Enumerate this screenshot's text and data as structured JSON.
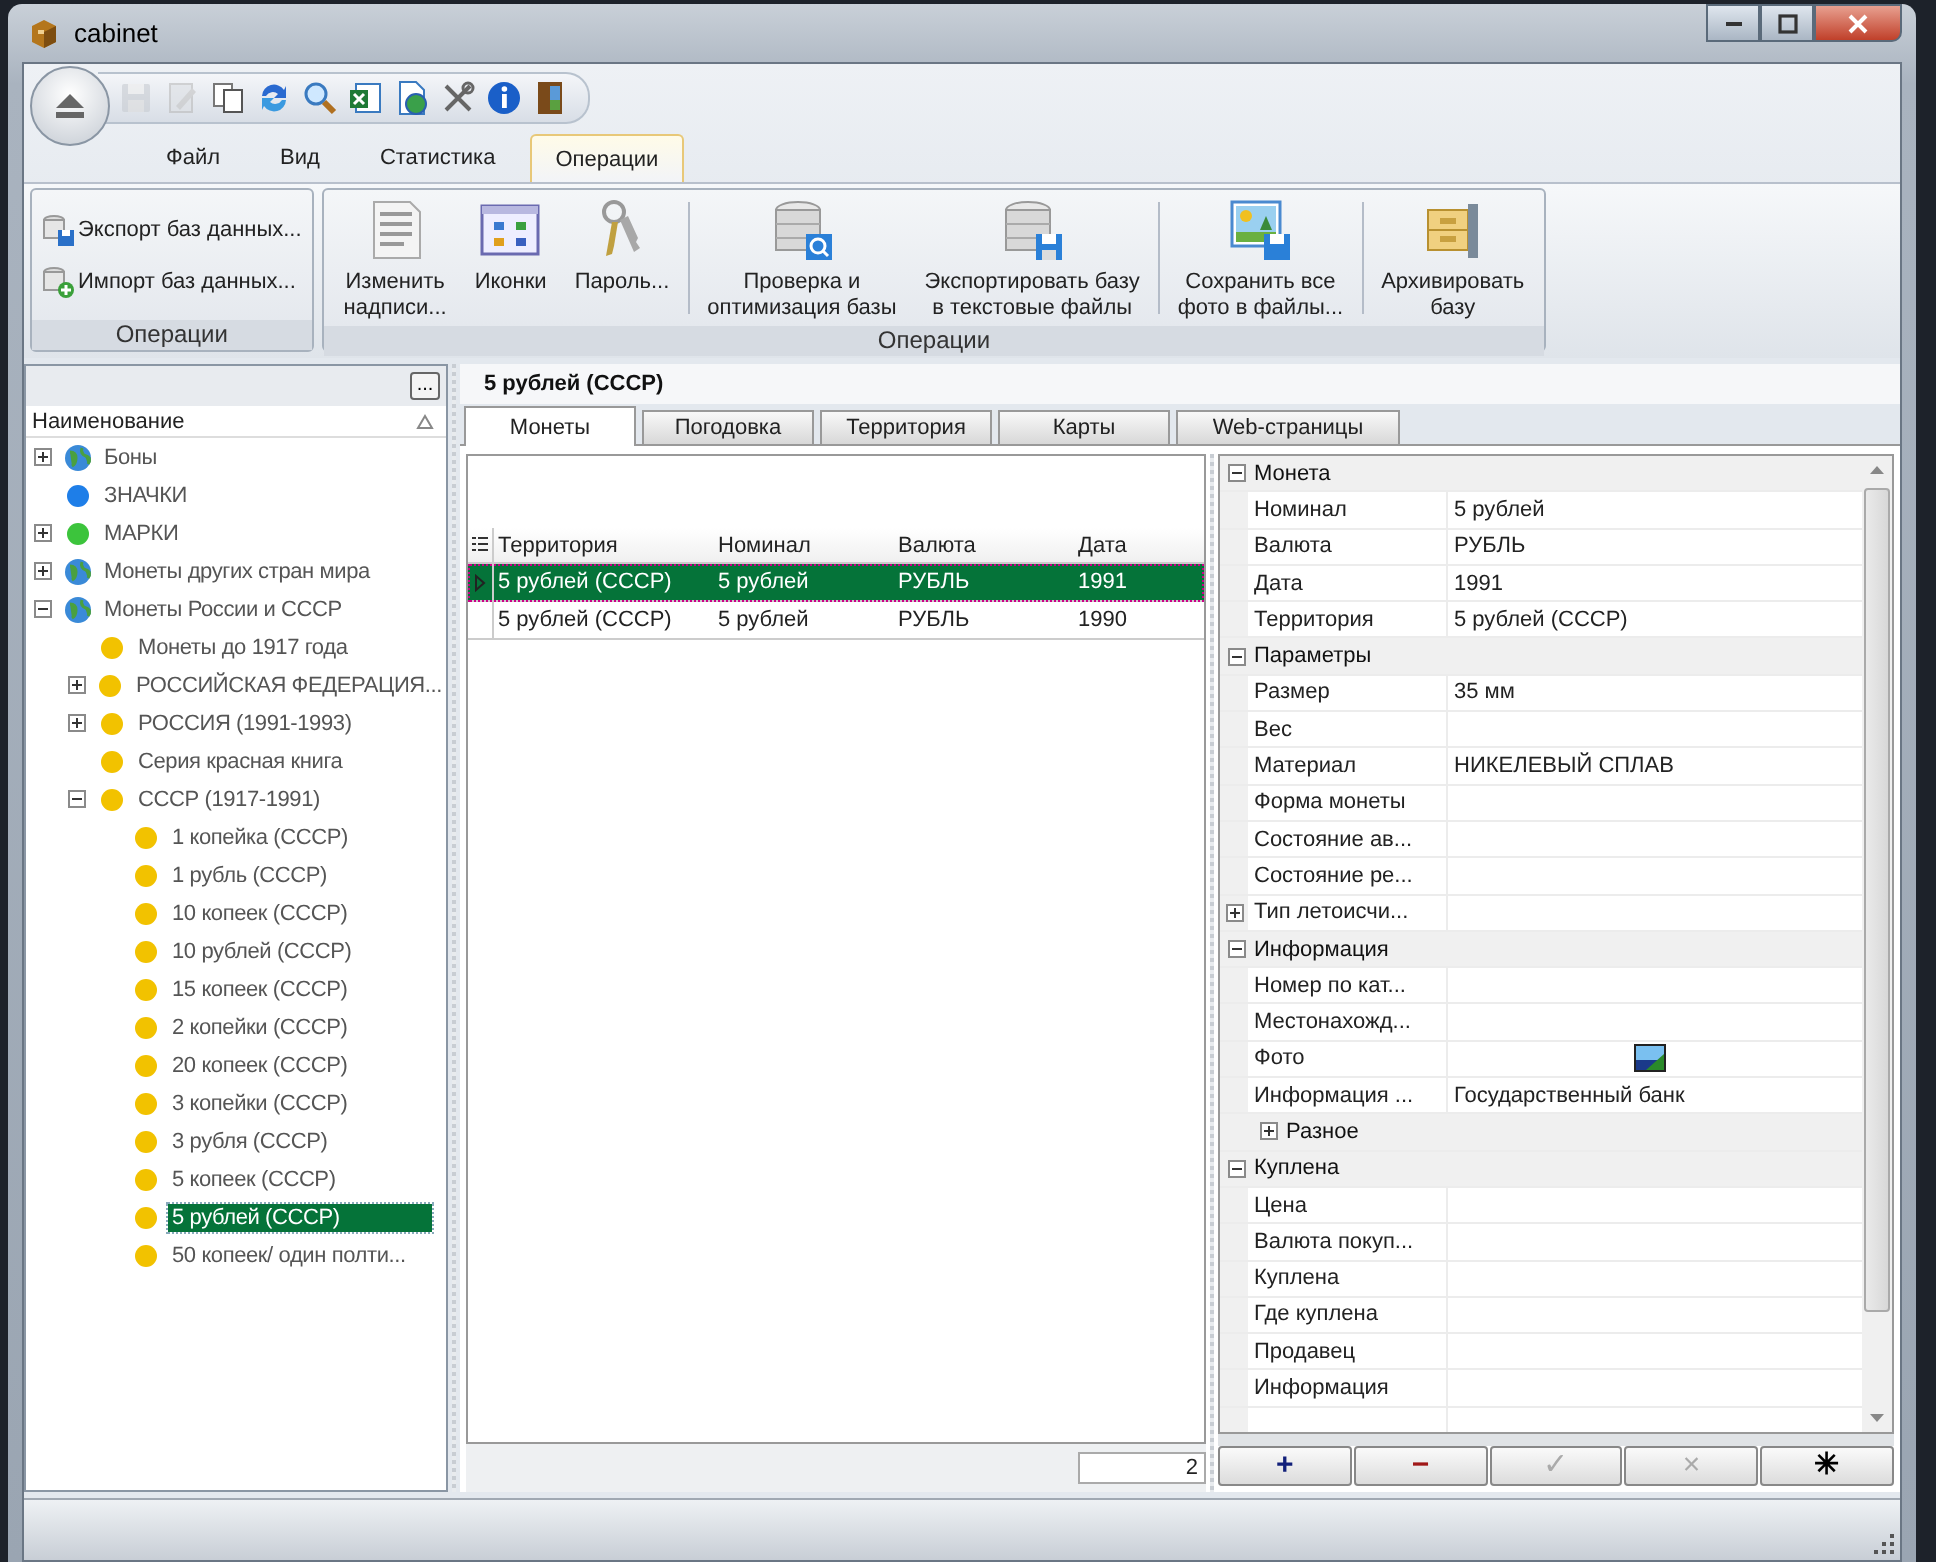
{
  "window": {
    "title": "cabinet"
  },
  "quick_access": [
    {
      "kind": "save",
      "disabled": true
    },
    {
      "kind": "edit",
      "disabled": true
    },
    {
      "kind": "copy",
      "disabled": false
    },
    {
      "kind": "refresh",
      "disabled": false
    },
    {
      "kind": "search",
      "disabled": false
    },
    {
      "kind": "excel",
      "disabled": false
    },
    {
      "kind": "web-doc",
      "disabled": false
    },
    {
      "kind": "tools",
      "disabled": false
    },
    {
      "kind": "info",
      "disabled": false
    },
    {
      "kind": "exit",
      "disabled": false
    }
  ],
  "ribbon_tabs": [
    {
      "label": "Файл",
      "selected": false
    },
    {
      "label": "Вид",
      "selected": false
    },
    {
      "label": "Статистика",
      "selected": false
    },
    {
      "label": "Операции",
      "selected": true
    }
  ],
  "ribbon_groups": [
    {
      "title": "Операции",
      "kind": "small",
      "buttons": [
        {
          "kind": "export",
          "label": "Экспорт баз данных..."
        },
        {
          "kind": "import",
          "label": "Импорт баз данных..."
        }
      ]
    },
    {
      "title": "Операции",
      "kind": "large",
      "sections": [
        {
          "buttons": [
            {
              "kind": "labels",
              "lines": [
                "Изменить",
                "надписи..."
              ]
            },
            {
              "kind": "icons",
              "lines": [
                "Иконки"
              ]
            },
            {
              "kind": "keys",
              "lines": [
                "Пароль..."
              ]
            }
          ]
        },
        {
          "buttons": [
            {
              "kind": "check",
              "lines": [
                "Проверка и",
                "оптимизация базы"
              ]
            },
            {
              "kind": "export",
              "lines": [
                "Экспортировать базу",
                "в текстовые файлы"
              ]
            }
          ]
        },
        {
          "buttons": [
            {
              "kind": "photos",
              "lines": [
                "Сохранить все",
                "фото в файлы..."
              ]
            }
          ]
        },
        {
          "buttons": [
            {
              "kind": "archive",
              "lines": [
                "Архивировать",
                "базу"
              ]
            }
          ]
        }
      ]
    }
  ],
  "tree_panel": {
    "options_button": "...",
    "header": "Наименование",
    "items": [
      {
        "label": "Боны",
        "kind": "globe",
        "expanded": false,
        "selected": false
      },
      {
        "label": "ЗНАЧКИ",
        "kind": "dot",
        "color": "#1e7ee8",
        "selected": false
      },
      {
        "label": "МАРКИ",
        "kind": "dot",
        "color": "#3cc43c",
        "expanded": false,
        "selected": false
      },
      {
        "label": "Монеты других стран мира",
        "kind": "globe",
        "expanded": false,
        "selected": false
      },
      {
        "label": "Монеты России и СССР",
        "kind": "globe",
        "expanded": true,
        "selected": false,
        "children": [
          {
            "label": "Монеты до 1917 года",
            "kind": "dot",
            "color": "#f2c200",
            "selected": false
          },
          {
            "label": "РОССИЙСКАЯ ФЕДЕРАЦИЯ...",
            "kind": "dot",
            "color": "#f2c200",
            "expanded": false,
            "selected": false
          },
          {
            "label": "РОССИЯ (1991-1993)",
            "kind": "dot",
            "color": "#f2c200",
            "expanded": false,
            "selected": false
          },
          {
            "label": "Серия красная книга",
            "kind": "dot",
            "color": "#f2c200",
            "selected": false
          },
          {
            "label": "СССР (1917-1991)",
            "kind": "dot",
            "color": "#f2c200",
            "expanded": true,
            "selected": false,
            "children": [
              {
                "label": "1 копейка (СССР)",
                "kind": "dot",
                "color": "#f2c200",
                "selected": false
              },
              {
                "label": "1 рубль (СССР)",
                "kind": "dot",
                "color": "#f2c200",
                "selected": false
              },
              {
                "label": "10 копеек (СССР)",
                "kind": "dot",
                "color": "#f2c200",
                "selected": false
              },
              {
                "label": "10 рублей (СССР)",
                "kind": "dot",
                "color": "#f2c200",
                "selected": false
              },
              {
                "label": "15 копеек (СССР)",
                "kind": "dot",
                "color": "#f2c200",
                "selected": false
              },
              {
                "label": "2 копейки (СССР)",
                "kind": "dot",
                "color": "#f2c200",
                "selected": false
              },
              {
                "label": "20 копеек (СССР)",
                "kind": "dot",
                "color": "#f2c200",
                "selected": false
              },
              {
                "label": "3 копейки (СССР)",
                "kind": "dot",
                "color": "#f2c200",
                "selected": false
              },
              {
                "label": "3 рубля (СССР)",
                "kind": "dot",
                "color": "#f2c200",
                "selected": false
              },
              {
                "label": "5 копеек (СССР)",
                "kind": "dot",
                "color": "#f2c200",
                "selected": false
              },
              {
                "label": "5 рублей (СССР)",
                "kind": "dot",
                "color": "#f2c200",
                "selected": true
              },
              {
                "label": "50 копеек/ один полти...",
                "kind": "dot",
                "color": "#f2c200",
                "selected": false
              }
            ]
          }
        ]
      }
    ]
  },
  "record": {
    "title": "5 рублей (СССР)",
    "tabs": [
      {
        "label": "Монеты",
        "selected": true
      },
      {
        "label": "Погодовка",
        "selected": false
      },
      {
        "label": "Территория",
        "selected": false
      },
      {
        "label": "Карты",
        "selected": false
      },
      {
        "label": "Web-страницы",
        "selected": false
      }
    ],
    "grid": {
      "columns": [
        "Территория",
        "Номинал",
        "Валюта",
        "Дата"
      ],
      "rows": [
        {
          "selected": true,
          "cells": [
            "5 рублей (СССР)",
            "5 рублей",
            "РУБЛЬ",
            "1991"
          ]
        },
        {
          "selected": false,
          "cells": [
            "5 рублей (СССР)",
            "5 рублей",
            "РУБЛЬ",
            "1990"
          ]
        }
      ],
      "count": "2"
    },
    "properties": [
      {
        "name": "Монета",
        "expanded": true,
        "rows": [
          {
            "kind": "field",
            "name": "Номинал",
            "value": "5 рублей"
          },
          {
            "kind": "field",
            "name": "Валюта",
            "value": "РУБЛЬ"
          },
          {
            "kind": "field",
            "name": "Дата",
            "value": "1991"
          },
          {
            "kind": "field",
            "name": "Территория",
            "value": "5 рублей (СССР)"
          }
        ]
      },
      {
        "name": "Параметры",
        "expanded": true,
        "rows": [
          {
            "kind": "field",
            "name": "Размер",
            "value": "35 мм"
          },
          {
            "kind": "field",
            "name": "Вес"
          },
          {
            "kind": "field",
            "name": "Материал",
            "value": "НИКЕЛЕВЫЙ СПЛАВ"
          },
          {
            "kind": "field",
            "name": "Форма монеты"
          },
          {
            "kind": "field",
            "name": "Состояние ав..."
          },
          {
            "kind": "field",
            "name": "Состояние ре..."
          },
          {
            "kind": "group",
            "name": "Тип летоисчи...",
            "expanded": false
          }
        ]
      },
      {
        "name": "Информация",
        "expanded": true,
        "rows": [
          {
            "kind": "field",
            "name": "Номер по кат..."
          },
          {
            "kind": "field",
            "name": "Местонахожд..."
          },
          {
            "kind": "photo",
            "name": "Фото"
          },
          {
            "kind": "field",
            "name": "Информация ...",
            "value": "Государственный банк"
          },
          {
            "kind": "subcategory",
            "name": "Разное",
            "expanded": false
          }
        ]
      },
      {
        "name": "Куплена",
        "expanded": true,
        "rows": [
          {
            "kind": "field",
            "name": "Цена"
          },
          {
            "kind": "field",
            "name": "Валюта покуп..."
          },
          {
            "kind": "field",
            "name": "Куплена"
          },
          {
            "kind": "field",
            "name": "Где куплена"
          },
          {
            "kind": "field",
            "name": "Продавец"
          },
          {
            "kind": "field",
            "name": "Информация"
          }
        ]
      }
    ],
    "buttons": [
      {
        "label": "+",
        "disabled": false,
        "color": "#12207a"
      },
      {
        "label": "−",
        "disabled": false,
        "color": "#a01818"
      },
      {
        "label": "✓",
        "disabled": true
      },
      {
        "label": "×",
        "disabled": true
      },
      {
        "label": "✳",
        "disabled": false
      }
    ]
  }
}
